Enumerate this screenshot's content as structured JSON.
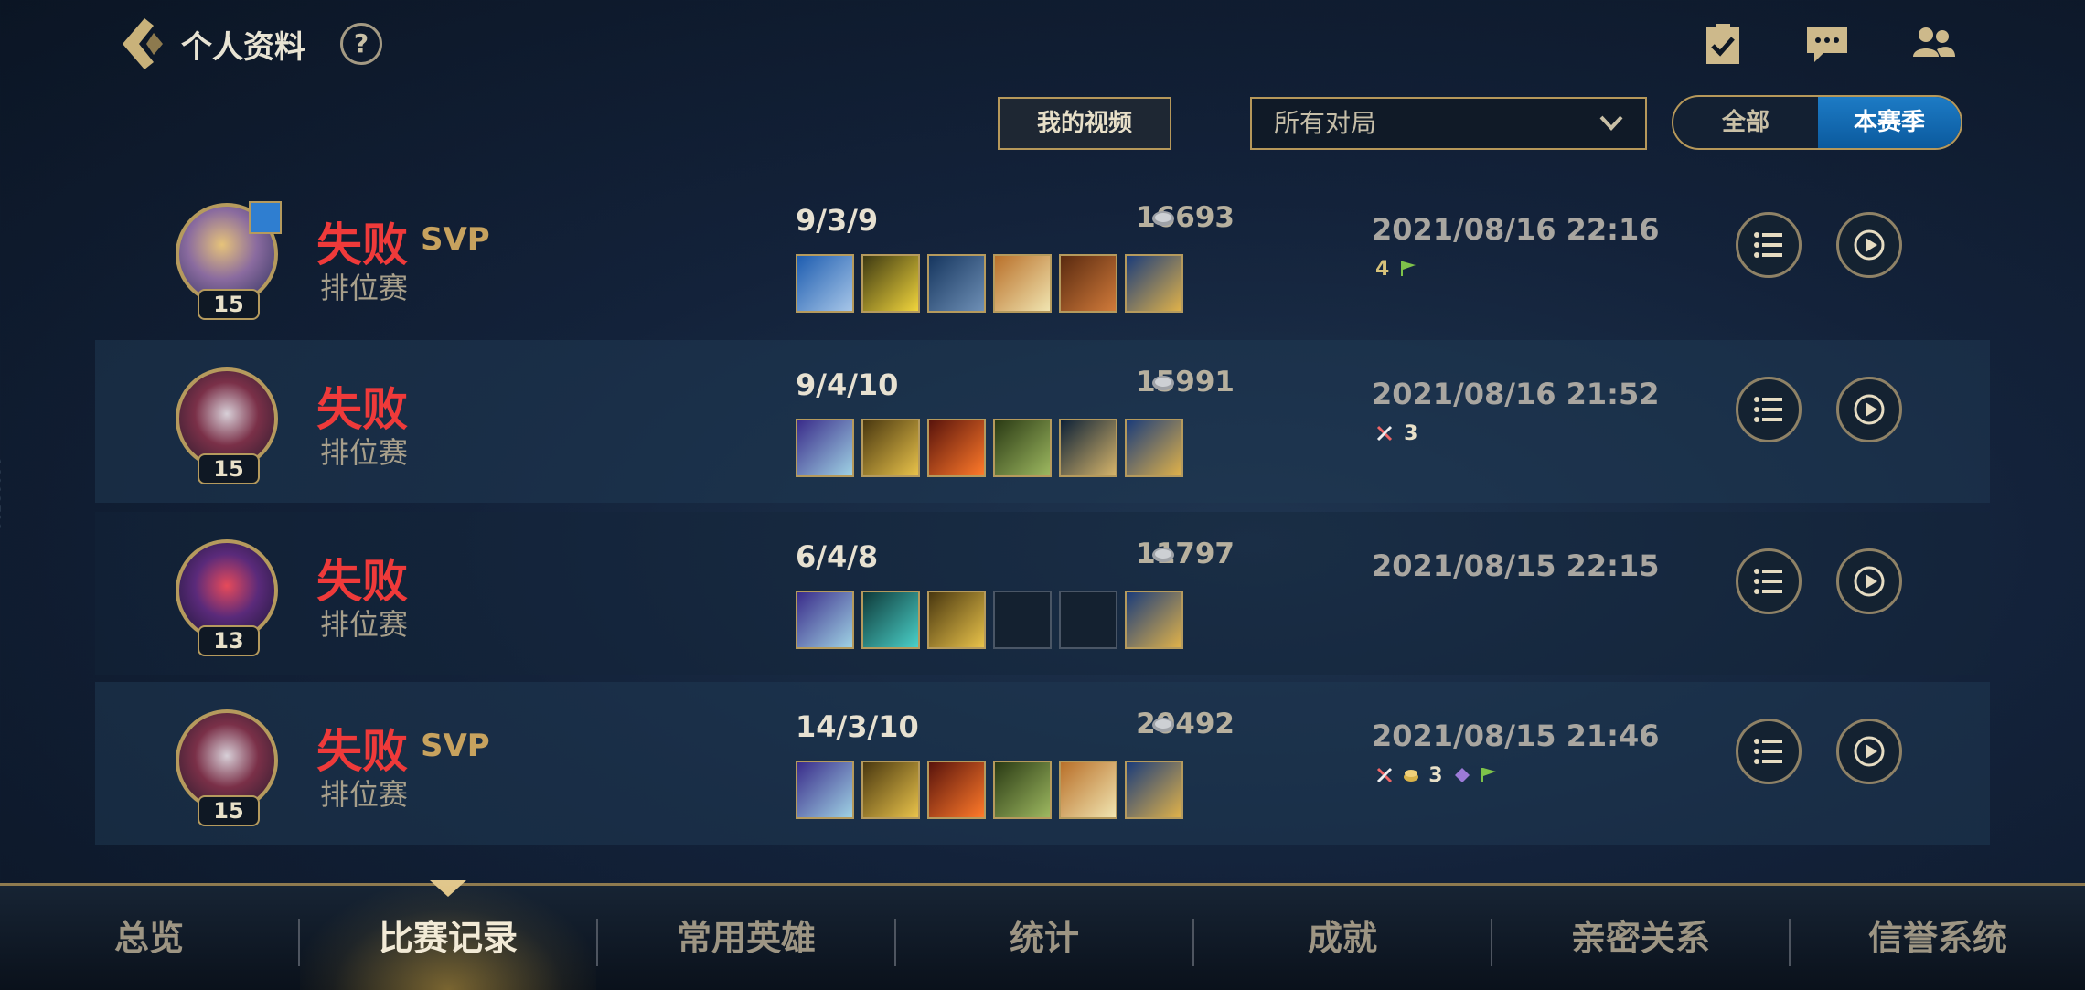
{
  "header": {
    "title": "个人资料",
    "help_glyph": "?"
  },
  "filters": {
    "video_button": "我的视频",
    "match_filter_value": "所有对局",
    "seg_all": "全部",
    "seg_season": "本赛季",
    "seg_selected": "本赛季"
  },
  "matches": [
    {
      "result": "失败",
      "svp": "SVP",
      "mode": "排位赛",
      "level": "15",
      "kda": "9/3/9",
      "gold": "16693",
      "date": "2021/08/16 22:16",
      "medal_text": "4",
      "empty_slots": 0
    },
    {
      "result": "失败",
      "svp": "",
      "mode": "排位赛",
      "level": "15",
      "kda": "9/4/10",
      "gold": "15991",
      "date": "2021/08/16 21:52",
      "medal_text": "3",
      "empty_slots": 0
    },
    {
      "result": "失败",
      "svp": "",
      "mode": "排位赛",
      "level": "13",
      "kda": "6/4/8",
      "gold": "11797",
      "date": "2021/08/15 22:15",
      "medal_text": "",
      "empty_slots": 2
    },
    {
      "result": "失败",
      "svp": "SVP",
      "mode": "排位赛",
      "level": "15",
      "kda": "14/3/10",
      "gold": "20492",
      "date": "2021/08/15 21:46",
      "medal_text": "3",
      "empty_slots": 0
    }
  ],
  "side_id": "16013712",
  "tabs": [
    {
      "label": "总览"
    },
    {
      "label": "比赛记录"
    },
    {
      "label": "常用英雄"
    },
    {
      "label": "统计"
    },
    {
      "label": "成就"
    },
    {
      "label": "亲密关系"
    },
    {
      "label": "信誉系统"
    }
  ],
  "active_tab": "比赛记录",
  "colors": {
    "accent_gold": "#b6985a",
    "loss_red": "#ef3a3a",
    "active_blue": "#1d7bc5"
  },
  "icons": {
    "back": "back-arrow-icon",
    "help": "help-icon",
    "task": "task-check-icon",
    "chat": "chat-icon",
    "friends": "friends-icon",
    "detail": "list-detail-icon",
    "replay": "replay-icon"
  }
}
